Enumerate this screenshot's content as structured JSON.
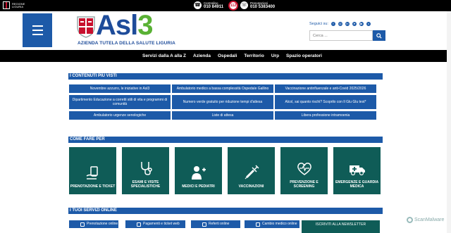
{
  "topbar": {
    "regione_label": "REGIONE LIGURIA",
    "centralino_label": "Centralino",
    "centralino_number": "010 84911",
    "emergency_number": "112",
    "prenotazioni_label": "Prenotazioni",
    "prenotazioni_number": "010 5383400"
  },
  "header": {
    "brand_main": "Asl",
    "brand_number": "3",
    "tagline": "AZIENDA TUTELA DELLA SALUTE LIGURIA",
    "social_label": "Seguici su:",
    "search_placeholder": "Cerca ..."
  },
  "nav": {
    "items": [
      "Servizi dalla A alla Z",
      "Azienda",
      "Ospedali",
      "Territorio",
      "Urp",
      "Spazio operatori"
    ]
  },
  "most_visited": {
    "title": "I CONTENUTI PIÙ VISTI",
    "items": [
      "Novembre azzurro, le iniziative in Asl3",
      "Ambulatorio medico a bassa complessità Ospedale Gallino",
      "Vaccinazione antinfluenzale e anti-Covid 2025/2026",
      "Dipartimento Educazione a corretti stili di vita e programmi di comunità",
      "Numero verde gratuito per riduzione tempi d'attesa",
      "Alcol, sai quanto rischi? Scoprilo con Il Glu Glu test*",
      "Ambulatorio urgenze senologiche",
      "Liste di attesa",
      "Libera professione intramoenia"
    ]
  },
  "come_fare": {
    "title": "COME FARE PER",
    "tiles": [
      "Prenotazione e ticket",
      "Esami e visite specialistiche",
      "Medici e pediatri",
      "Vaccinazioni",
      "Prevenzione e screening",
      "Emergenze e guardia medica"
    ]
  },
  "servizi_online": {
    "title": "I TUOI SERVIZI ONLINE",
    "items": [
      "Prenotazione online",
      "Pagamenti e ticket web",
      "Referti online",
      "Cambio medico online"
    ],
    "newsletter": "ISCRIVITI ALLA NEWSLETTER"
  },
  "watermark": "ScanMalware",
  "colors": {
    "primary": "#1d5aa8",
    "tile": "#0f5c57",
    "brand_green": "#59b134",
    "bar": "#000000"
  }
}
